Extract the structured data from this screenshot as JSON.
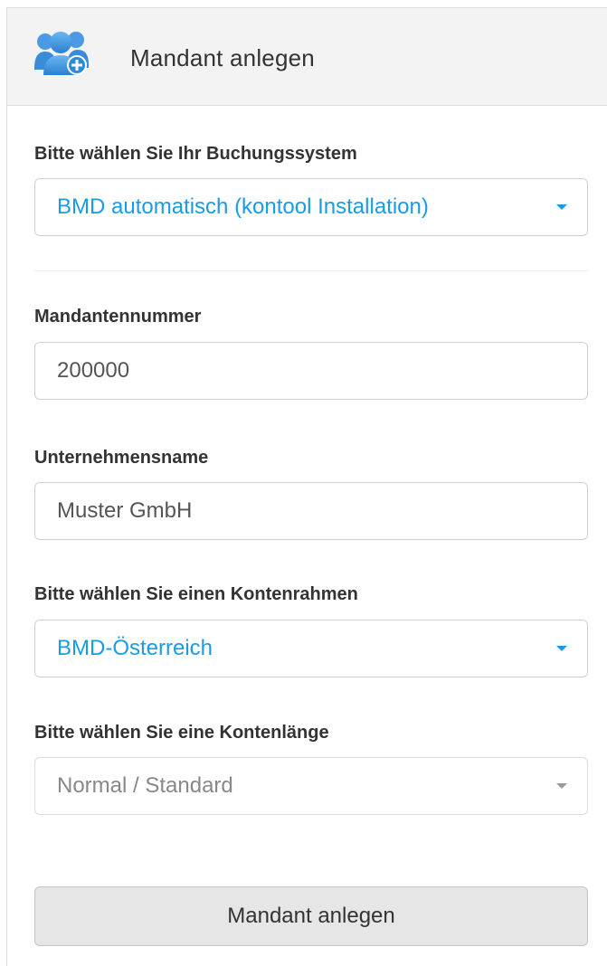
{
  "header": {
    "icon": "add-user-group-icon",
    "title": "Mandant anlegen"
  },
  "form": {
    "booking_system": {
      "label": "Bitte wählen Sie Ihr Buchungssystem",
      "value": "BMD automatisch (kontool Installation)"
    },
    "client_number": {
      "label": "Mandantennummer",
      "value": "200000"
    },
    "company_name": {
      "label": "Unternehmensname",
      "value": "Muster GmbH"
    },
    "chart_of_accounts": {
      "label": "Bitte wählen Sie einen Kontenrahmen",
      "value": "BMD-Österreich"
    },
    "account_length": {
      "label": "Bitte wählen Sie eine Kontenlänge",
      "value": "Normal / Standard"
    },
    "submit_label": "Mandant anlegen"
  },
  "colors": {
    "accent": "#1a9be6",
    "header_bg": "#f3f3f3",
    "button_bg": "#e6e6e6"
  }
}
